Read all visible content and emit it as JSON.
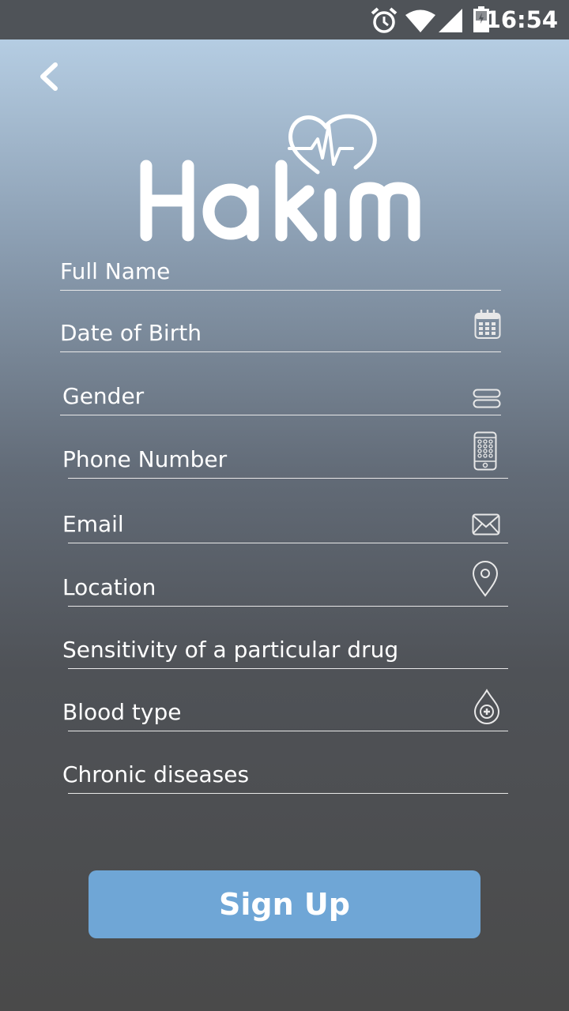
{
  "status_bar": {
    "time": "16:54",
    "icons": [
      "alarm-icon",
      "wifi-icon",
      "signal-icon",
      "battery-icon"
    ]
  },
  "header": {
    "back_icon": "chevron-left-icon",
    "logo_text": "Hakim"
  },
  "form": {
    "fields": [
      {
        "label": "Full Name",
        "icon": ""
      },
      {
        "label": "Date of Birth",
        "icon": "calendar-icon"
      },
      {
        "label": "Gender",
        "icon": "select-icon"
      },
      {
        "label": "Phone Number",
        "icon": "phone-icon"
      },
      {
        "label": "Email",
        "icon": "envelope-icon"
      },
      {
        "label": "Location",
        "icon": "map-pin-icon"
      },
      {
        "label": "Sensitivity of a particular drug",
        "icon": ""
      },
      {
        "label": "Blood type",
        "icon": "blood-drop-icon"
      },
      {
        "label": "Chronic diseases",
        "icon": ""
      }
    ]
  },
  "signup_button": {
    "label": "Sign Up"
  },
  "colors": {
    "accent": "#6fa6d6",
    "status_bar": "#4f5358"
  }
}
